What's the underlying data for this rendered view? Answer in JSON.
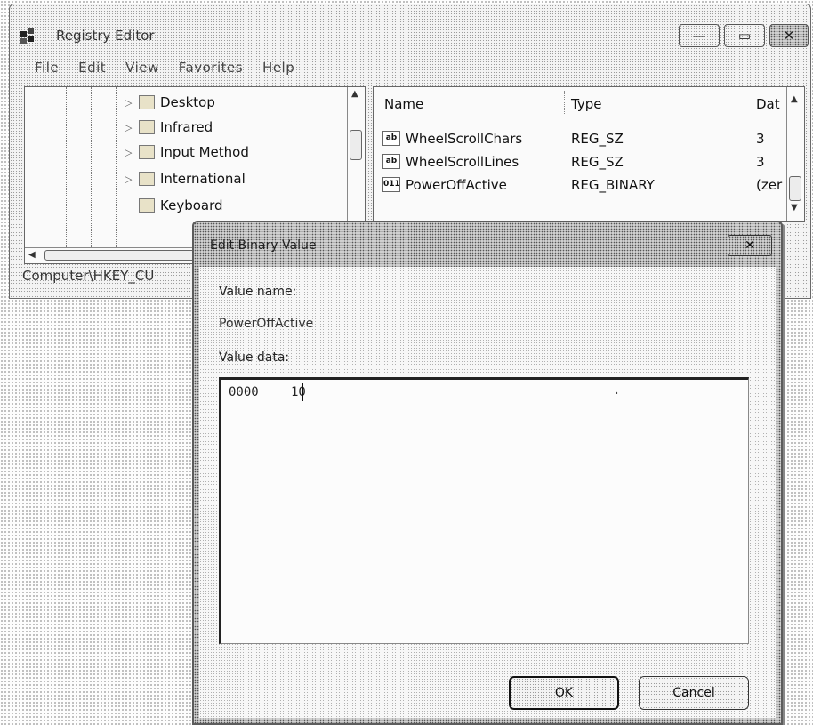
{
  "window": {
    "title": "Registry Editor",
    "minimize_glyph": "—",
    "maximize_glyph": "▭",
    "close_glyph": "✕"
  },
  "menu": [
    "File",
    "Edit",
    "View",
    "Favorites",
    "Help"
  ],
  "tree": {
    "items": [
      {
        "label": "Desktop",
        "expander": "▷"
      },
      {
        "label": "Infrared",
        "expander": "▷"
      },
      {
        "label": "Input Method",
        "expander": "▷"
      },
      {
        "label": "International",
        "expander": "▷"
      },
      {
        "label": "Keyboard",
        "expander": ""
      }
    ]
  },
  "values": {
    "columns": [
      "Name",
      "Type",
      "Dat"
    ],
    "rows": [
      {
        "icon": "ab",
        "name": "WheelScrollChars",
        "type": "REG_SZ",
        "data": "3"
      },
      {
        "icon": "ab",
        "name": "WheelScrollLines",
        "type": "REG_SZ",
        "data": "3"
      },
      {
        "icon": "011",
        "name": "PowerOffActive",
        "type": "REG_BINARY",
        "data": "(zer"
      }
    ]
  },
  "statusbar": {
    "path": "Computer\\HKEY_CU"
  },
  "dialog": {
    "title": "Edit Binary Value",
    "close_glyph": "✕",
    "value_name_label": "Value name:",
    "value_name": "PowerOffActive",
    "value_data_label": "Value data:",
    "hex_offset": "0000",
    "hex_bytes": "10",
    "ascii": ".",
    "ok_label": "OK",
    "cancel_label": "Cancel"
  }
}
